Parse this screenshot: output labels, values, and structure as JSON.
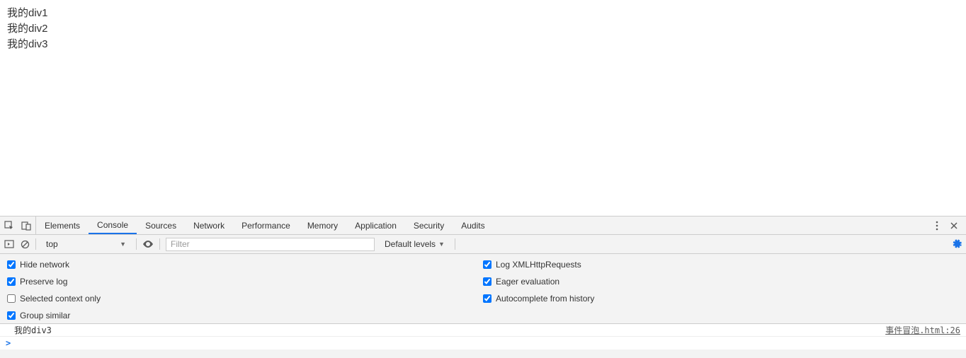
{
  "page": {
    "lines": [
      "我的div1",
      "我的div2",
      "我的div3"
    ]
  },
  "devtools": {
    "tabs": [
      "Elements",
      "Console",
      "Sources",
      "Network",
      "Performance",
      "Memory",
      "Application",
      "Security",
      "Audits"
    ],
    "active_tab": "Console",
    "subbar": {
      "context": "top",
      "filter_placeholder": "Filter",
      "levels": "Default levels"
    },
    "settings": {
      "left": [
        {
          "label": "Hide network",
          "checked": true
        },
        {
          "label": "Preserve log",
          "checked": true
        },
        {
          "label": "Selected context only",
          "checked": false
        },
        {
          "label": "Group similar",
          "checked": true
        }
      ],
      "right": [
        {
          "label": "Log XMLHttpRequests",
          "checked": true
        },
        {
          "label": "Eager evaluation",
          "checked": true
        },
        {
          "label": "Autocomplete from history",
          "checked": true
        }
      ]
    },
    "console": {
      "message": "我的div3",
      "source": "事件冒泡.html:26"
    }
  }
}
